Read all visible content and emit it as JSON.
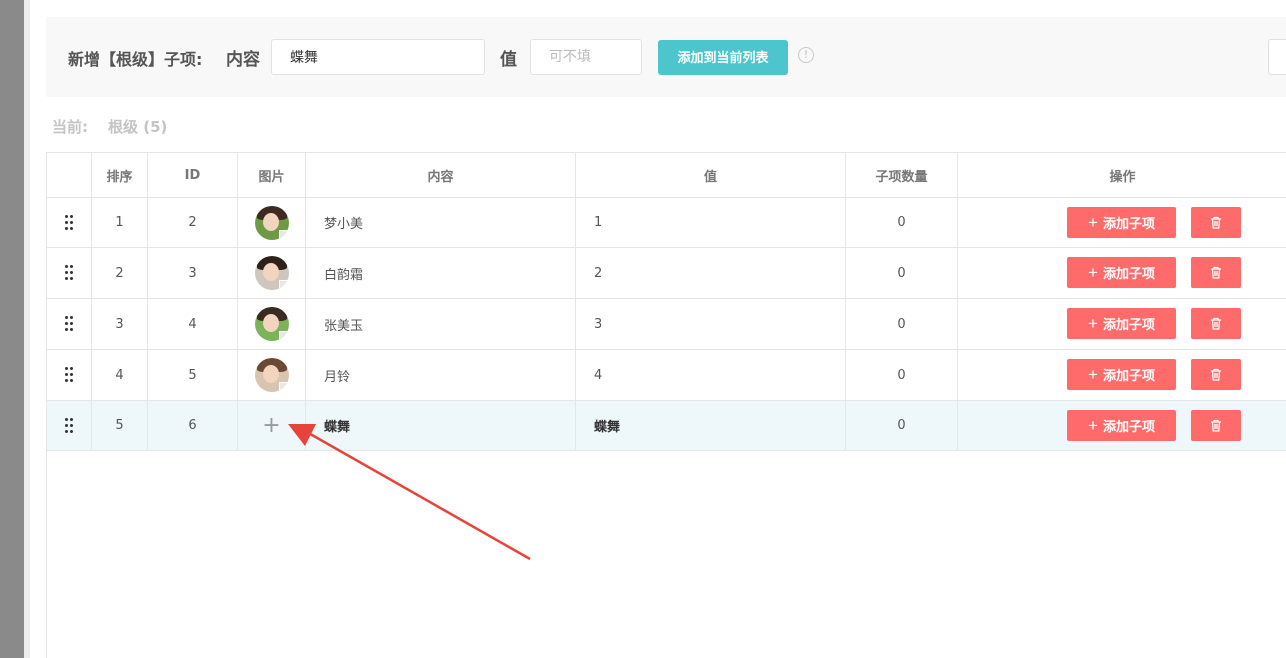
{
  "form": {
    "title": "新增【根级】子项:",
    "content_label": "内容",
    "content_value": "蝶舞",
    "value_label": "值",
    "value_placeholder": "可不填",
    "add_button": "添加到当前列表"
  },
  "current": {
    "label": "当前:",
    "value": "根级 (5)"
  },
  "table": {
    "headers": {
      "sort": "排序",
      "id": "ID",
      "image": "图片",
      "content": "内容",
      "value": "值",
      "child_count": "子项数量",
      "actions": "操作"
    },
    "add_child_label": "添加子项",
    "rows": [
      {
        "sort": "1",
        "id": "2",
        "content": "梦小美",
        "value": "1",
        "child_count": "0",
        "image": "avatar-photo"
      },
      {
        "sort": "2",
        "id": "3",
        "content": "白韵霜",
        "value": "2",
        "child_count": "0",
        "image": "avatar-photo"
      },
      {
        "sort": "3",
        "id": "4",
        "content": "张美玉",
        "value": "3",
        "child_count": "0",
        "image": "avatar-photo"
      },
      {
        "sort": "4",
        "id": "5",
        "content": "月铃",
        "value": "4",
        "child_count": "0",
        "image": "avatar-photo"
      },
      {
        "sort": "5",
        "id": "6",
        "content": "蝶舞",
        "value": "蝶舞",
        "child_count": "0",
        "image": "upload-plus-icon"
      }
    ]
  },
  "colors": {
    "accent_teal": "#4cc6cc",
    "danger_red": "#ff6b6b",
    "highlight_row": "#eef8fa",
    "annotation_arrow": "#e8433a"
  }
}
